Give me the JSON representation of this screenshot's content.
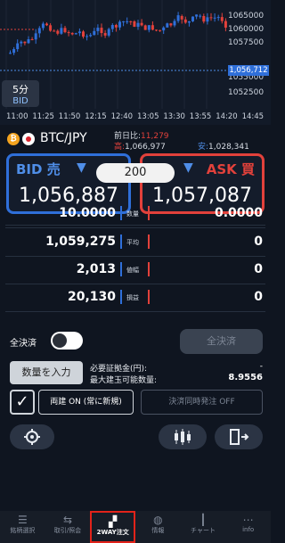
{
  "chart": {
    "timeframe_value": "5分",
    "timeframe_side": "BID",
    "current_price": "1,056,712",
    "y_ticks": [
      "1065000",
      "1060000",
      "1057500",
      "1055000",
      "1052500"
    ],
    "x_ticks": [
      "11:00",
      "11:25",
      "11:50",
      "12:15",
      "12:40",
      "13:05",
      "13:30",
      "13:55",
      "14:20",
      "14:45"
    ],
    "colors": {
      "up": "#2f6fd9",
      "down": "#e2413b",
      "price_tag": "#2f6fd9",
      "bg": "#121a28"
    }
  },
  "pair": {
    "name": "BTC/JPY",
    "prev_day_label": "前日比:",
    "prev_day_value": "11,279",
    "high_label": "高:",
    "high_value": "1,066,977",
    "low_label": "安:",
    "low_value": "1,028,341"
  },
  "quote": {
    "bid_label": "BID 売",
    "bid_price": "1,056,887",
    "ask_label": "ASK 買",
    "ask_price": "1,057,087",
    "spread": "200",
    "colors": {
      "bid": "#2f6fd9",
      "ask": "#e2413b"
    }
  },
  "stats": {
    "rows": [
      {
        "left": "10.0000",
        "label": "数量",
        "right": "0.0000"
      },
      {
        "left": "1,059,275",
        "label": "平均",
        "right": "0"
      },
      {
        "left": "2,013",
        "label": "値幅",
        "right": "0"
      },
      {
        "left": "20,130",
        "label": "損益",
        "right": "0"
      }
    ]
  },
  "controls": {
    "close_all_label": "全決済",
    "close_all_button": "全決済",
    "qty_input_button": "数量を入力",
    "margin_label": "必要証拠金(円):",
    "margin_value": "-",
    "max_qty_label": "最大建玉可能数量:",
    "max_qty_value": "8.9556",
    "both_on_label": "両建 ON (常に新規)",
    "settle_off_label": "決済同時発注 OFF"
  },
  "nav": {
    "items": [
      {
        "label": "銘柄選択",
        "icon": "list-icon"
      },
      {
        "label": "取引/照会",
        "icon": "trade-icon"
      },
      {
        "label": "2WAY注文",
        "icon": "twoway-icon"
      },
      {
        "label": "情報",
        "icon": "globe-icon"
      },
      {
        "label": "チャート",
        "icon": "candle-icon"
      },
      {
        "label": "info",
        "icon": "grid-icon"
      }
    ],
    "active_index": 2,
    "active_border_color": "#e2231a"
  }
}
